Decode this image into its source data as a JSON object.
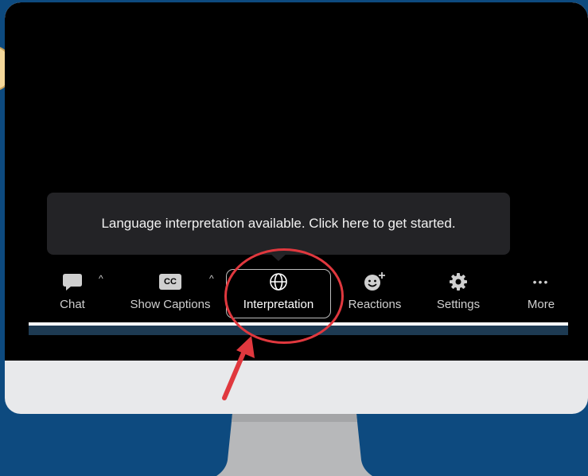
{
  "tooltip": {
    "text": "Language interpretation available. Click here to get started."
  },
  "toolbar": {
    "items": [
      {
        "label": "Chat",
        "icon": "chat-bubble-icon"
      },
      {
        "label": "Show Captions",
        "icon": "cc-icon",
        "icon_text": "CC"
      },
      {
        "label": "Interpretation",
        "icon": "globe-icon"
      },
      {
        "label": "Reactions",
        "icon": "emoji-add-icon"
      },
      {
        "label": "Settings",
        "icon": "gear-icon"
      },
      {
        "label": "More",
        "icon": "more-dots-icon",
        "icon_text": "•••"
      }
    ],
    "caret": "^"
  },
  "colors": {
    "page_background": "#0d4a7f",
    "screen": "#000000",
    "monitor_bezel": "#e8e9eb",
    "tooltip_background": "#232326",
    "highlight_red": "#e0383e",
    "active_border": "#bdbdbd"
  }
}
